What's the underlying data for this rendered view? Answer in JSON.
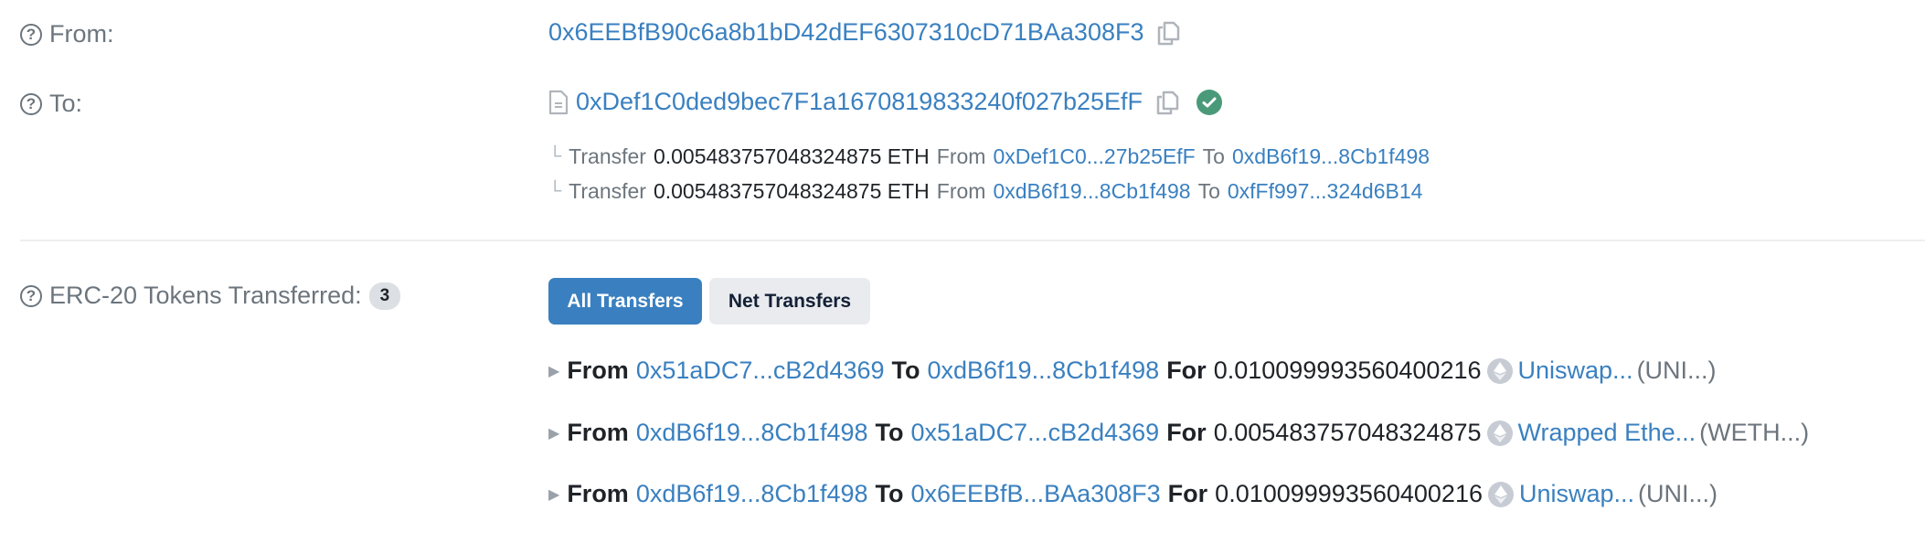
{
  "from": {
    "label": "From:",
    "address": "0x6EEBfB90c6a8b1bD42dEF6307310cD71BAa308F3"
  },
  "to": {
    "label": "To:",
    "address": "0xDef1C0ded9bec7F1a1670819833240f027b25EfF",
    "verified": true,
    "internal_transfers": [
      {
        "type_label": "Transfer",
        "amount": "0.005483757048324875 ETH",
        "from_label": "From",
        "from": "0xDef1C0...27b25EfF",
        "to_label": "To",
        "to": "0xdB6f19...8Cb1f498"
      },
      {
        "type_label": "Transfer",
        "amount": "0.005483757048324875 ETH",
        "from_label": "From",
        "from": "0xdB6f19...8Cb1f498",
        "to_label": "To",
        "to": "0xfFf997...324d6B14"
      }
    ]
  },
  "erc20": {
    "label": "ERC-20 Tokens Transferred:",
    "count": "3",
    "tabs": [
      {
        "label": "All Transfers",
        "active": true
      },
      {
        "label": "Net Transfers",
        "active": false
      }
    ],
    "transfers": [
      {
        "from_label": "From",
        "from": "0x51aDC7...cB2d4369",
        "to_label": "To",
        "to": "0xdB6f19...8Cb1f498",
        "for_label": "For",
        "amount": "0.010099993560400216",
        "token_icon": "ethereum-icon",
        "token_name": "Uniswap...",
        "token_symbol": "(UNI...)"
      },
      {
        "from_label": "From",
        "from": "0xdB6f19...8Cb1f498",
        "to_label": "To",
        "to": "0x51aDC7...cB2d4369",
        "for_label": "For",
        "amount": "0.005483757048324875",
        "token_icon": "ethereum-icon",
        "token_name": "Wrapped Ethe...",
        "token_symbol": "(WETH...)"
      },
      {
        "from_label": "From",
        "from": "0xdB6f19...8Cb1f498",
        "to_label": "To",
        "to": "0x6EEBfB...BAa308F3",
        "for_label": "For",
        "amount": "0.010099993560400216",
        "token_icon": "ethereum-icon",
        "token_name": "Uniswap...",
        "token_symbol": "(UNI...)"
      }
    ]
  },
  "colors": {
    "link": "#3a80c0",
    "muted": "#6c757d",
    "verified": "#4a9a7a",
    "primary_button": "#3a80c0",
    "secondary_button": "#e9ebef"
  }
}
